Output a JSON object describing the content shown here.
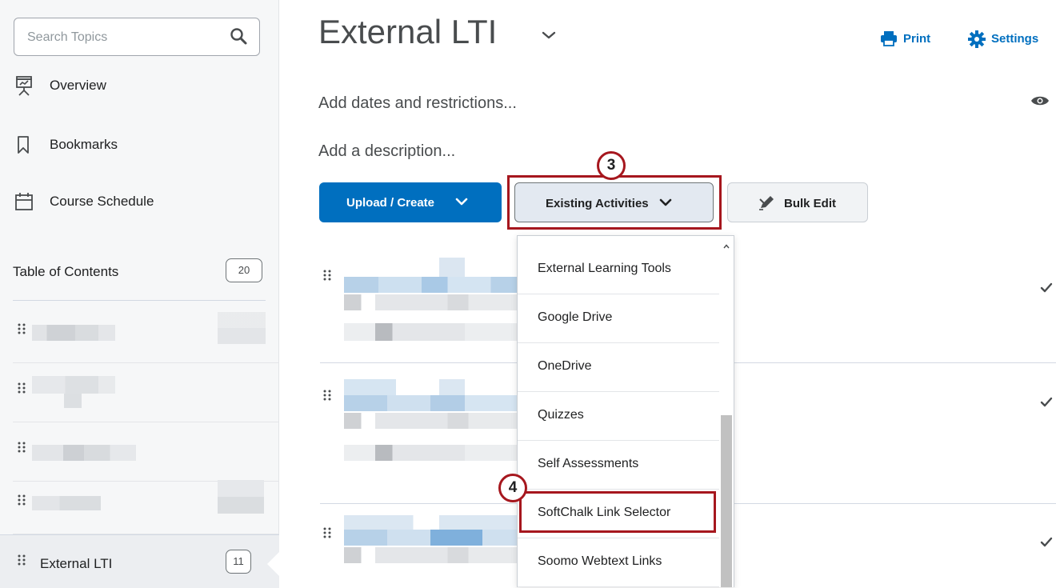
{
  "sidebar": {
    "search_placeholder": "Search Topics",
    "nav": [
      {
        "label": "Overview",
        "icon": "presentation-icon"
      },
      {
        "label": "Bookmarks",
        "icon": "bookmark-icon"
      },
      {
        "label": "Course Schedule",
        "icon": "calendar-icon"
      }
    ],
    "toc": {
      "label": "Table of Contents",
      "count": "20"
    },
    "active_module": {
      "label": "External LTI",
      "count": "11"
    }
  },
  "header": {
    "title": "External LTI",
    "print_label": "Print",
    "settings_label": "Settings"
  },
  "main": {
    "add_dates": "Add dates and restrictions...",
    "add_description": "Add a description...",
    "upload_label": "Upload / Create",
    "existing_label": "Existing Activities",
    "bulk_label": "Bulk Edit"
  },
  "callouts": {
    "step3": "3",
    "step4": "4"
  },
  "dropdown": {
    "items": [
      "External Learning Tools",
      "Google Drive",
      "OneDrive",
      "Quizzes",
      "Self Assessments",
      "SoftChalk Link Selector",
      "Soomo Webtext Links"
    ]
  },
  "colors": {
    "brand_blue": "#006fbf",
    "callout_red": "#a6171e"
  }
}
